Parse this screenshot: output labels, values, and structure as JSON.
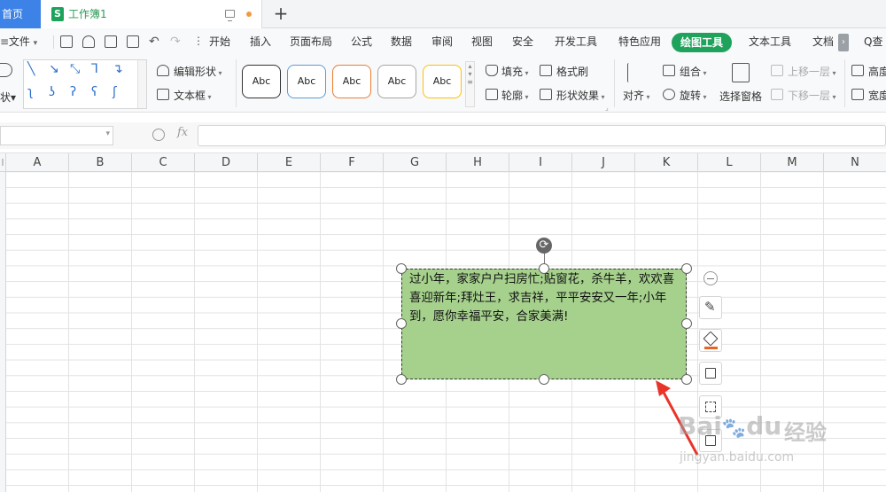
{
  "tabs": {
    "home_label": "首页",
    "doc_icon_letter": "S",
    "doc_title": "工作簿1",
    "new_tab_label": "+"
  },
  "menu": {
    "file_label": "文件",
    "file_caret": "▾",
    "items": [
      "开始",
      "插入",
      "页面布局",
      "公式",
      "数据",
      "审阅",
      "视图",
      "安全",
      "开发工具",
      "特色应用",
      "绘图工具",
      "文本工具",
      "文档"
    ],
    "active_item": "绘图工具",
    "more_label": "›",
    "search_label": "Q查"
  },
  "ribbon": {
    "left_cut_label": "状▾",
    "edit_shape_label": "编辑形状",
    "textbox_label": "文本框",
    "style_samples": [
      "Abc",
      "Abc",
      "Abc",
      "Abc",
      "Abc"
    ],
    "style_colors": [
      "#333333",
      "#5b9bd5",
      "#ed7d31",
      "#a5a5a5",
      "#ffc000"
    ],
    "fill_label": "填充",
    "format_brush_label": "格式刷",
    "outline_label": "轮廓",
    "shape_effect_label": "形状效果",
    "align_label": "对齐",
    "group_label": "组合",
    "rotate_label": "旋转",
    "selection_pane_label": "选择窗格",
    "bring_forward_label": "上移一层",
    "send_backward_label": "下移一层",
    "height_label": "高度",
    "width_label": "宽度"
  },
  "formula_bar": {
    "fx_label": "fx",
    "name_box_value": "",
    "formula_value": ""
  },
  "sheet": {
    "columns": [
      "A",
      "B",
      "C",
      "D",
      "E",
      "F",
      "G",
      "H",
      "I",
      "J",
      "K",
      "L",
      "M",
      "N"
    ],
    "first_col_fragment": "I"
  },
  "shape": {
    "fill_color": "#a6d18d",
    "text": "过小年，家家户户扫房忙;贴窗花，杀牛羊，欢欢喜喜迎新年;拜灶王，求吉祥，平平安安又一年;小年到，愿你幸福平安，合家美满!"
  },
  "floating_toolbar": {
    "buttons": [
      "collapse",
      "outline-pen",
      "fill-bucket",
      "shape-style",
      "text-wrap",
      "layout"
    ]
  },
  "annotation": {
    "arrow_color": "#e8342a"
  },
  "watermark": {
    "brand": "Bai",
    "brand_suffix": "du",
    "product": "经验",
    "url": "jingyan.baidu.com"
  }
}
